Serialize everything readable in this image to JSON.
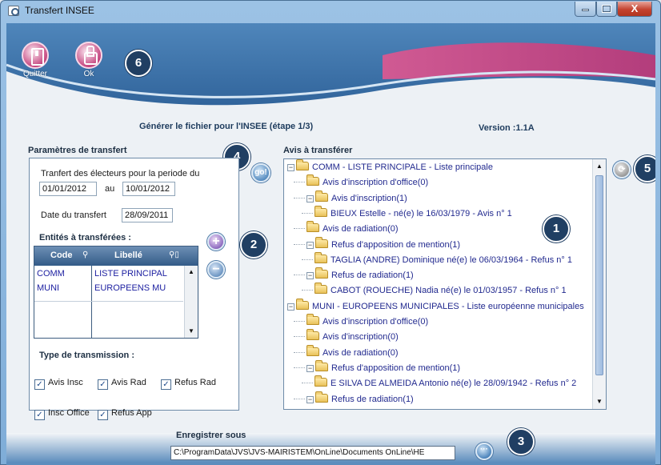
{
  "window": {
    "title": "Transfert INSEE",
    "buttons": {
      "minimize": "",
      "maximize": "",
      "close": "X"
    }
  },
  "toolbar": {
    "quit_label": "Quitter",
    "ok_label": "Ok"
  },
  "header": {
    "step_text": "Générer le fichier pour l'INSEE (étape 1/3)",
    "version_text": "Version :1.1A"
  },
  "badges": [
    "1",
    "2",
    "3",
    "4",
    "5",
    "6"
  ],
  "params": {
    "title": "Paramètres de transfert",
    "period_label": "Tranfert des électeurs pour la periode du",
    "date_from": "01/01/2012",
    "au_label": "au",
    "date_to": "10/01/2012",
    "transfer_date_label": "Date du transfert",
    "transfer_date": "28/09/2011",
    "go_label": "go!",
    "entities_title": "Entités à transférées :",
    "grid": {
      "columns": [
        "Code",
        "Libellé"
      ],
      "rows": [
        {
          "code": "COMM",
          "libelle": "LISTE PRINCIPAL"
        },
        {
          "code": "MUNI",
          "libelle": "EUROPEENS MU"
        }
      ]
    },
    "transmission_title": "Type de transmission :",
    "checkboxes": [
      {
        "label": "Avis Insc",
        "checked": true
      },
      {
        "label": "Avis Rad",
        "checked": true
      },
      {
        "label": "Refus Rad",
        "checked": true
      },
      {
        "label": "Insc Office",
        "checked": true
      },
      {
        "label": "Refus App",
        "checked": true
      }
    ]
  },
  "avis": {
    "title": "Avis à transférer",
    "tree": [
      {
        "level": 0,
        "expandable": true,
        "text": "COMM - LISTE PRINCIPALE - Liste principale"
      },
      {
        "level": 1,
        "expandable": false,
        "text": "Avis d'inscription d'office(0)"
      },
      {
        "level": 1,
        "expandable": true,
        "text": "Avis d'inscription(1)"
      },
      {
        "level": 2,
        "expandable": false,
        "text": "BIEUX Estelle - né(e) le 16/03/1979 - Avis n° 1"
      },
      {
        "level": 1,
        "expandable": false,
        "text": "Avis de radiation(0)"
      },
      {
        "level": 1,
        "expandable": true,
        "text": "Refus d'apposition de mention(1)"
      },
      {
        "level": 2,
        "expandable": false,
        "text": "TAGLIA (ANDRE) Dominique né(e) le 06/03/1964 - Refus n° 1"
      },
      {
        "level": 1,
        "expandable": true,
        "text": "Refus de radiation(1)"
      },
      {
        "level": 2,
        "expandable": false,
        "text": "CABOT (ROUECHE) Nadia né(e) le 01/03/1957 - Refus n° 1"
      },
      {
        "level": 0,
        "expandable": true,
        "text": "MUNI - EUROPEENS MUNICIPALES - Liste européenne municipales"
      },
      {
        "level": 1,
        "expandable": false,
        "text": "Avis d'inscription d'office(0)"
      },
      {
        "level": 1,
        "expandable": false,
        "text": "Avis d'inscription(0)"
      },
      {
        "level": 1,
        "expandable": false,
        "text": "Avis de radiation(0)"
      },
      {
        "level": 1,
        "expandable": true,
        "text": "Refus d'apposition de mention(1)"
      },
      {
        "level": 2,
        "expandable": false,
        "text": "E SILVA DE ALMEIDA Antonio né(e) le 28/09/1942 - Refus n° 2"
      },
      {
        "level": 1,
        "expandable": true,
        "text": "Refus de radiation(1)"
      }
    ]
  },
  "save": {
    "label": "Enregistrer sous",
    "path": "C:\\ProgramData\\JVS\\JVS-MAIRISTEM\\OnLine\\Documents OnLine\\HE",
    "browse_label": "···"
  },
  "colors": {
    "badge": "#203f63",
    "accent_magenta": "#c5467f",
    "tree_text": "#222a8f"
  }
}
